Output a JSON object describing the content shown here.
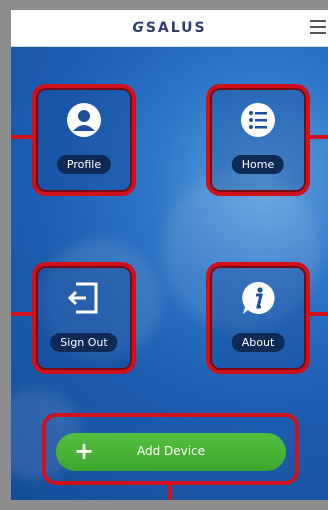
{
  "app": {
    "brand": "SALUS"
  },
  "tiles": [
    {
      "label": "Profile",
      "icon": "profile-icon"
    },
    {
      "label": "Home",
      "icon": "home-list-icon"
    },
    {
      "label": "Sign Out",
      "icon": "sign-out-icon"
    },
    {
      "label": "About",
      "icon": "info-icon"
    }
  ],
  "add_device": {
    "label": "Add Device",
    "icon": "plus-icon"
  },
  "colors": {
    "highlight": "#d0111b",
    "add_button": "#48b236",
    "brand": "#2e3e70"
  }
}
